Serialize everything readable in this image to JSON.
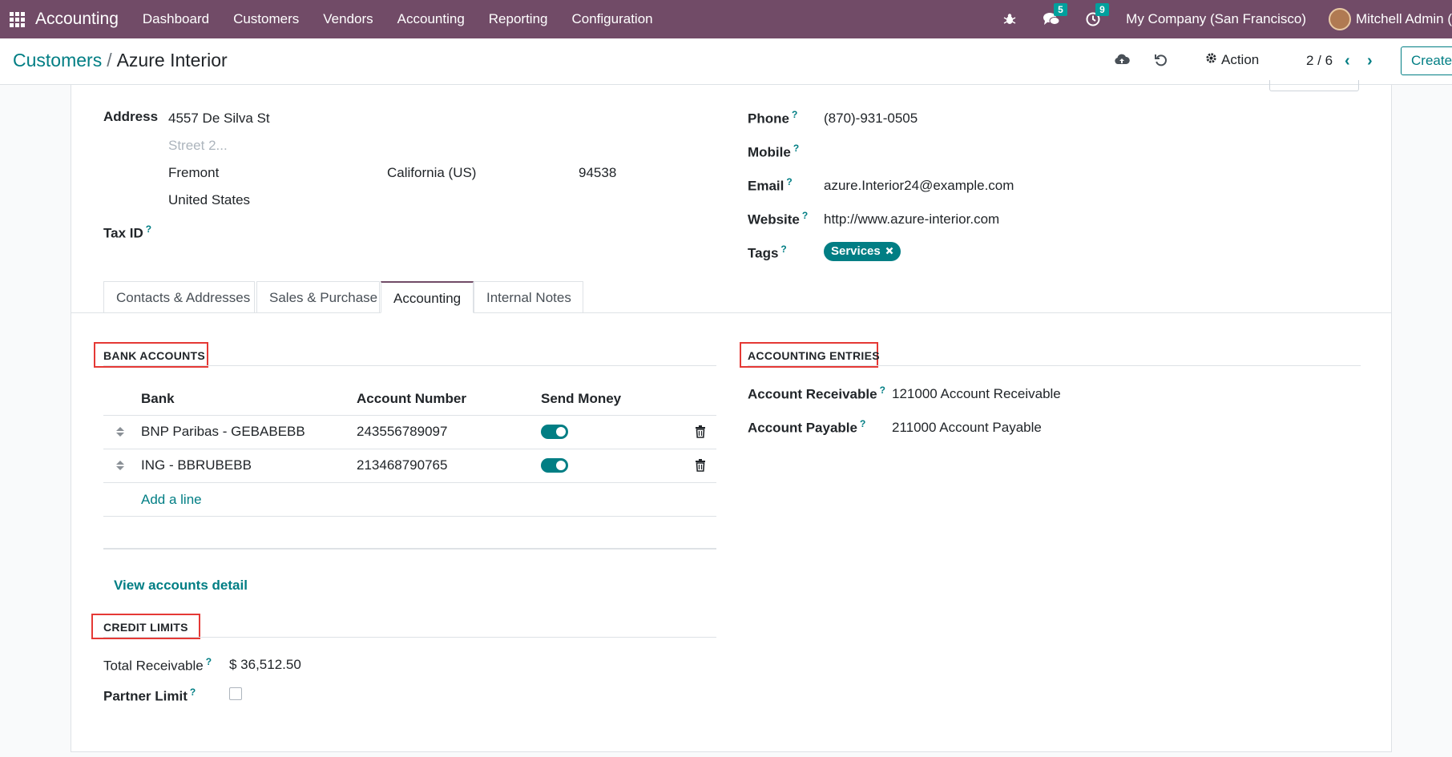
{
  "navbar": {
    "app_name": "Accounting",
    "menu": [
      "Dashboard",
      "Customers",
      "Vendors",
      "Accounting",
      "Reporting",
      "Configuration"
    ],
    "messages_count": "5",
    "activities_count": "9",
    "company": "My Company (San Francisco)",
    "user": "Mitchell Admin (Ei"
  },
  "control_panel": {
    "breadcrumb_parent": "Customers",
    "breadcrumb_separator": "/",
    "breadcrumb_current": "Azure Interior",
    "action_label": "Action",
    "pager": "2 / 6",
    "create_label": "Create"
  },
  "form": {
    "address_label": "Address",
    "street": "4557 De Silva St",
    "street2_placeholder": "Street 2...",
    "city": "Fremont",
    "state": "California (US)",
    "zip": "94538",
    "country": "United States",
    "tax_id_label": "Tax ID",
    "phone_label": "Phone",
    "phone": "(870)-931-0505",
    "mobile_label": "Mobile",
    "mobile": "",
    "email_label": "Email",
    "email": "azure.Interior24@example.com",
    "website_label": "Website",
    "website": "http://www.azure-interior.com",
    "tags_label": "Tags",
    "tag": "Services",
    "help_mark": "?"
  },
  "tabs": [
    "Contacts & Addresses",
    "Sales & Purchase",
    "Accounting",
    "Internal Notes"
  ],
  "active_tab": "Accounting",
  "bank_accounts": {
    "title": "BANK ACCOUNTS",
    "columns": [
      "Bank",
      "Account Number",
      "Send Money"
    ],
    "rows": [
      {
        "bank": "BNP Paribas - GEBABEBB",
        "account_number": "243556789097",
        "send_money": true
      },
      {
        "bank": "ING - BBRUBEBB",
        "account_number": "213468790765",
        "send_money": true
      }
    ],
    "add_line": "Add a line",
    "view_detail": "View accounts detail"
  },
  "accounting_entries": {
    "title": "ACCOUNTING ENTRIES",
    "receivable_label": "Account Receivable",
    "receivable_value": "121000 Account Receivable",
    "payable_label": "Account Payable",
    "payable_value": "211000 Account Payable"
  },
  "credit_limits": {
    "title": "CREDIT LIMITS",
    "total_receivable_label": "Total Receivable",
    "total_receivable_value": "$ 36,512.50",
    "partner_limit_label": "Partner Limit",
    "partner_limit_checked": false
  },
  "colors": {
    "navbar": "#714B67",
    "accent": "#017e84",
    "highlight_box": "#e53935"
  }
}
